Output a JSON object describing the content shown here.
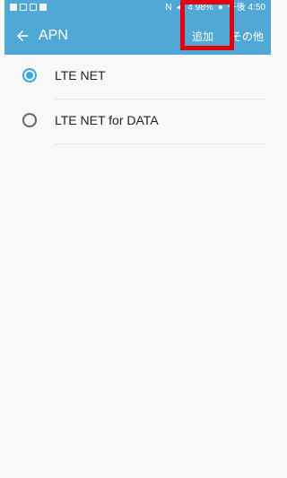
{
  "status_bar": {
    "right_text": [
      "N",
      "◀",
      "4 98%",
      "●",
      "午後 4:50"
    ]
  },
  "toolbar": {
    "title": "APN",
    "add_label": "追加",
    "more_label": "その他"
  },
  "apn_list": {
    "items": [
      {
        "label": "LTE NET",
        "selected": true
      },
      {
        "label": "LTE NET for DATA",
        "selected": false
      }
    ]
  },
  "colors": {
    "toolbar_bg": "#4fa8d5",
    "accent": "#39a8de",
    "highlight": "#e3000f"
  }
}
